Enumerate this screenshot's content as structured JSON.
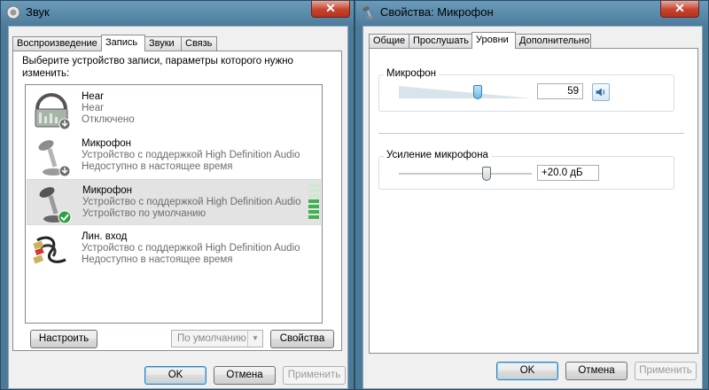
{
  "left_window": {
    "title": "Звук",
    "close_glyph": "✕",
    "tabs": [
      "Воспроизведение",
      "Запись",
      "Звуки",
      "Связь"
    ],
    "active_tab": "Запись",
    "instruction": "Выберите устройство записи, параметры которого нужно изменить:",
    "devices": [
      {
        "name": "Hear",
        "line1": "Hear",
        "line2": "Отключено",
        "icon": "mixer-disabled-icon"
      },
      {
        "name": "Микрофон",
        "line1": "Устройство с поддержкой High Definition Audio",
        "line2": "Недоступно в настоящее время",
        "icon": "microphone-unplugged-icon"
      },
      {
        "name": "Микрофон",
        "line1": "Устройство с поддержкой High Definition Audio",
        "line2": "Устройство по умолчанию",
        "icon": "microphone-default-icon",
        "selected": true
      },
      {
        "name": "Лин. вход",
        "line1": "Устройство с поддержкой High Definition Audio",
        "line2": "Недоступно в настоящее время",
        "icon": "line-in-cable-icon"
      }
    ],
    "buttons": {
      "configure": "Настроить",
      "default_combo": "По умолчанию",
      "properties": "Свойства",
      "ok": "OK",
      "cancel": "Отмена",
      "apply": "Применить"
    }
  },
  "right_window": {
    "title": "Свойства: Микрофон",
    "close_glyph": "✕",
    "tabs": [
      "Общие",
      "Прослушать",
      "Уровни",
      "Дополнительно"
    ],
    "active_tab": "Уровни",
    "microphone": {
      "label": "Микрофон",
      "value": "59",
      "level": 59
    },
    "boost": {
      "label": "Усиление микрофона",
      "value": "+20.0 дБ",
      "level_fraction": 0.66
    },
    "buttons": {
      "ok": "OK",
      "cancel": "Отмена",
      "apply": "Применить"
    }
  },
  "colors": {
    "accent": "#3c7fb1",
    "meter_green": "#2ea043",
    "close_red": "#c7432e"
  }
}
